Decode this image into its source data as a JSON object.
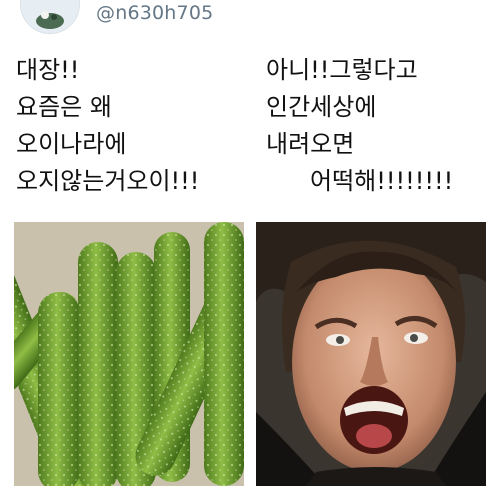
{
  "user": {
    "handle": "@n630h705"
  },
  "left_caption": [
    "대장!!",
    "요즘은 왜",
    "오이나라에",
    "오지않는거오이!!!"
  ],
  "right_caption": [
    "아니!!그렇다고",
    "인간세상에",
    "내려오면",
    "어떡해!!!!!!!!"
  ],
  "images": {
    "left": "cucumbers-photo",
    "right": "screaming-man-photo"
  },
  "colors": {
    "handle": "#657786",
    "text": "#111111",
    "cucumber": "#6e9a2c"
  }
}
